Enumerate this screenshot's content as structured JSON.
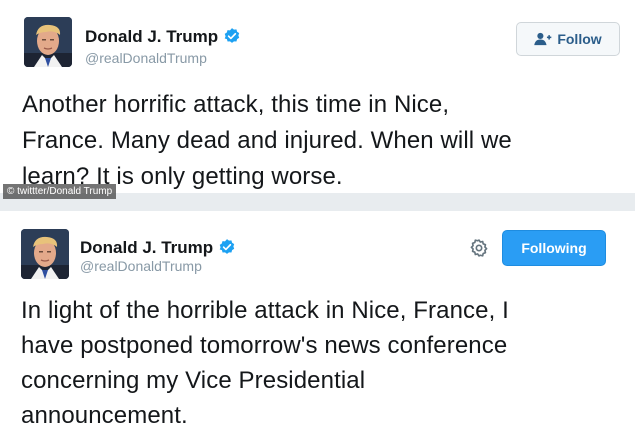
{
  "tweets": [
    {
      "name": "Donald J. Trump",
      "handle": "@realDonaldTrump",
      "button_label": "Follow",
      "text_lines": [
        "Another horrific attack, this time in Nice,",
        "France. Many dead and injured. When will we",
        "learn? It is only getting worse."
      ]
    },
    {
      "name": "Donald J. Trump",
      "handle": "@realDonaldTrump",
      "button_label": "Following",
      "text_lines": [
        "In light of the horrible attack in Nice, France, I",
        "have postponed tomorrow's news conference",
        "concerning my Vice Presidential",
        "announcement."
      ]
    }
  ],
  "watermark": "© twittter/Donald Trump",
  "colors": {
    "verified": "#1da1f2",
    "following_button": "#2a9df4",
    "follow_text": "#2b5d8a",
    "handle": "#8899a6"
  },
  "icons": [
    "verified-badge-icon",
    "follow-person-icon",
    "gear-icon"
  ]
}
